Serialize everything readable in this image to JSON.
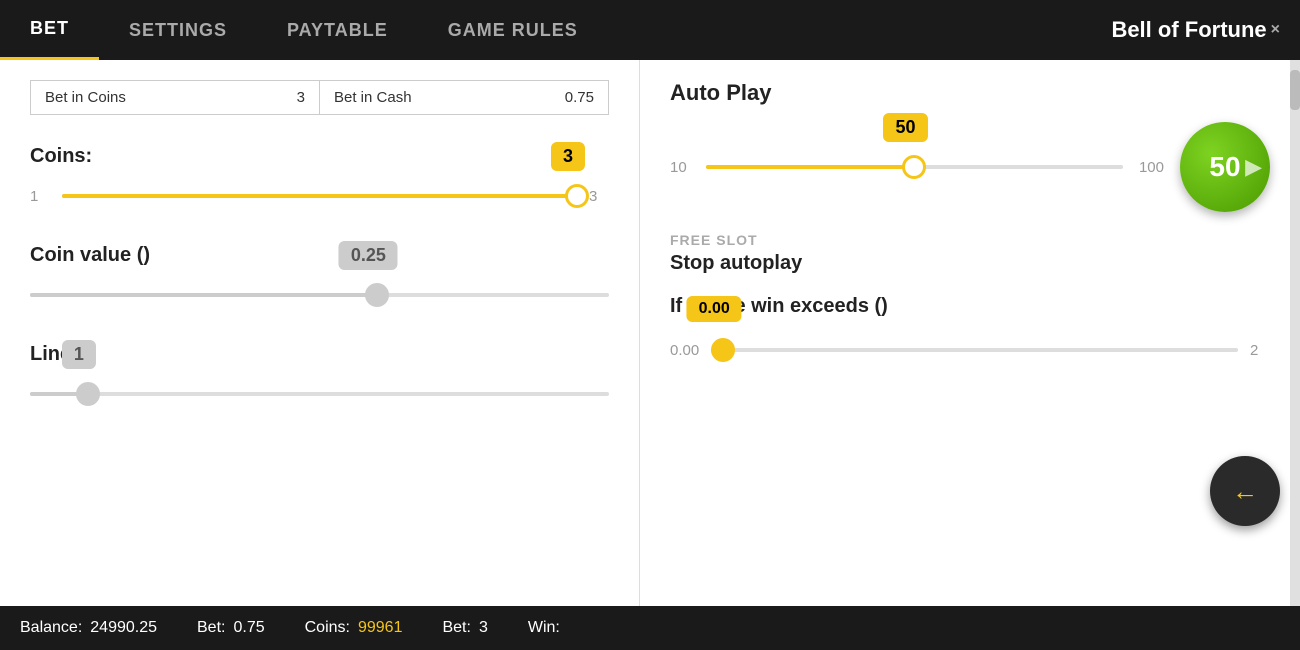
{
  "nav": {
    "tabs": [
      {
        "label": "BET",
        "active": true
      },
      {
        "label": "SETTINGS",
        "active": false
      },
      {
        "label": "PAYTABLE",
        "active": false
      },
      {
        "label": "GAME RULES",
        "active": false
      }
    ],
    "title": "Bell of Fortune",
    "close_label": "×"
  },
  "left_panel": {
    "bet_in_coins_label": "Bet in Coins",
    "bet_in_coins_value": "3",
    "bet_in_cash_label": "Bet in Cash",
    "bet_in_cash_value": "0.75",
    "coins_section": {
      "label": "Coins:",
      "min": "1",
      "max": "3",
      "current_value": "3",
      "fill_percent": 100
    },
    "coin_value_section": {
      "label": "Coin value ()",
      "current_value": "0.25",
      "fill_percent": 60
    },
    "lines_section": {
      "label": "Lines",
      "current_value": "1",
      "fill_percent": 10
    }
  },
  "right_panel": {
    "autoplay_label": "Auto Play",
    "autoplay_value": "50",
    "autoplay_min": "10",
    "autoplay_max": "100",
    "autoplay_fill_percent": 50,
    "autoplay_button_value": "50",
    "free_slot_label": "FREE SLOT",
    "stop_autoplay_label": "Stop autoplay",
    "single_win_label": "If single win exceeds ()",
    "single_win_value": "0.00",
    "single_win_min": "0.00",
    "single_win_max": "2",
    "single_win_fill_percent": 0,
    "back_arrow": "←"
  },
  "status_bar": {
    "balance_label": "Balance:",
    "balance_value": "24990.25",
    "bet_label": "Bet:",
    "bet_value": "0.75",
    "coins_label": "Coins:",
    "coins_value": "99961",
    "bet2_label": "Bet:",
    "bet2_value": "3",
    "win_label": "Win:",
    "win_value": ""
  }
}
